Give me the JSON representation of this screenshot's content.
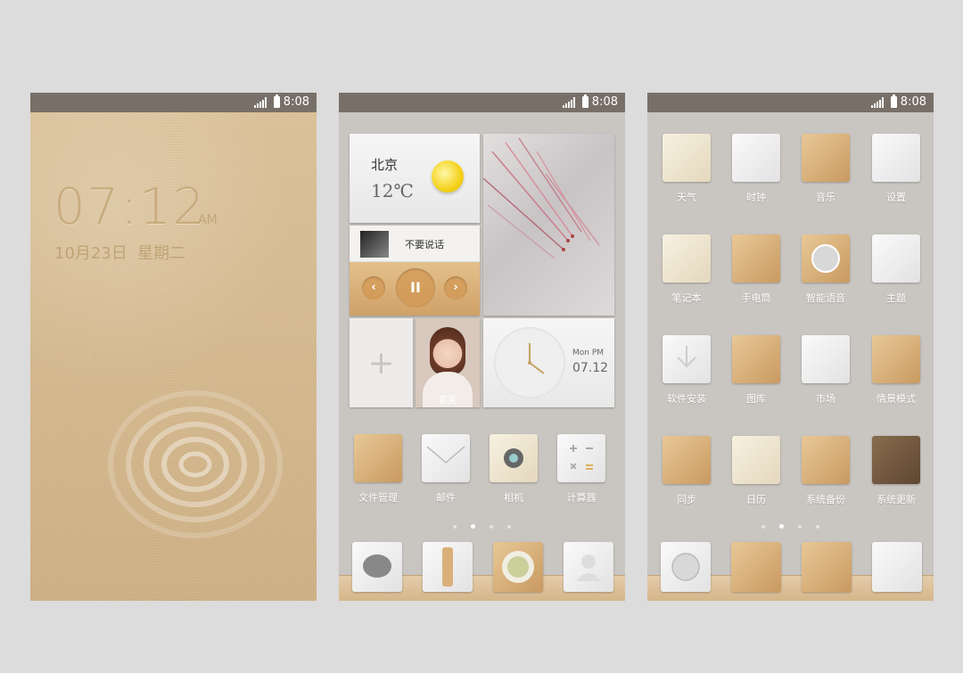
{
  "status_bar": {
    "time": "8:08"
  },
  "lock_screen": {
    "time": "07:12",
    "ampm": "AM",
    "date": "10月23日",
    "weekday": "星期二"
  },
  "home1": {
    "weather": {
      "city": "北京",
      "temp": "12℃"
    },
    "music": {
      "song": "不要说话",
      "prev": "‹",
      "play": "II",
      "next": "›"
    },
    "add_tile": {
      "symbol": "+"
    },
    "contact": {
      "name": "若美"
    },
    "clock": {
      "day": "Mon PM",
      "date": "07.12"
    },
    "apps": [
      {
        "label": "文件管理",
        "icon": "folder-icon"
      },
      {
        "label": "邮件",
        "icon": "envelope-icon"
      },
      {
        "label": "相机",
        "icon": "camera-icon"
      },
      {
        "label": "计算器",
        "icon": "calculator-icon"
      }
    ],
    "dock": [
      {
        "icon": "message-icon"
      },
      {
        "icon": "phone-icon"
      },
      {
        "icon": "browser-icon"
      },
      {
        "icon": "contacts-icon"
      }
    ]
  },
  "home2": {
    "apps": [
      {
        "label": "天气",
        "icon": "weather-icon"
      },
      {
        "label": "时钟",
        "icon": "clock-icon"
      },
      {
        "label": "音乐",
        "icon": "music-icon"
      },
      {
        "label": "设置",
        "icon": "settings-icon"
      },
      {
        "label": "笔记本",
        "icon": "notebook-icon"
      },
      {
        "label": "手电筒",
        "icon": "flashlight-icon"
      },
      {
        "label": "智能语音",
        "icon": "voice-icon"
      },
      {
        "label": "主题",
        "icon": "theme-icon"
      },
      {
        "label": "软件安装",
        "icon": "download-icon"
      },
      {
        "label": "图库",
        "icon": "gallery-icon"
      },
      {
        "label": "市场",
        "icon": "market-icon"
      },
      {
        "label": "情景模式",
        "icon": "profile-mode-icon"
      },
      {
        "label": "同步",
        "icon": "sync-icon"
      },
      {
        "label": "日历",
        "icon": "calendar-icon"
      },
      {
        "label": "系统备份",
        "icon": "backup-icon"
      },
      {
        "label": "系统更新",
        "icon": "update-icon"
      }
    ],
    "dock": [
      {
        "icon": "voice-dial-icon"
      },
      {
        "icon": "radio-icon"
      },
      {
        "icon": "toolbox-icon"
      },
      {
        "icon": "blank-app-icon"
      }
    ]
  }
}
